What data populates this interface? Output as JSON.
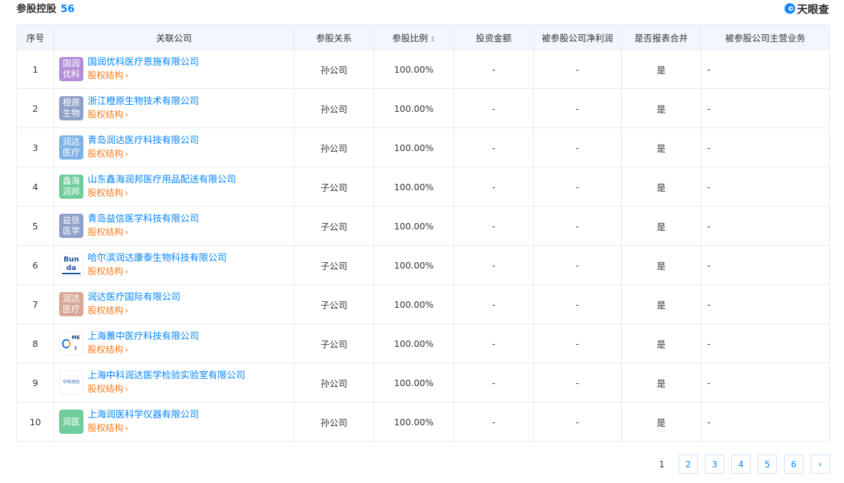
{
  "header": {
    "title": "参股控股",
    "count": "56",
    "brand": "天眼查"
  },
  "columns": [
    "序号",
    "关联公司",
    "参股关系",
    "参股比例",
    "投资金额",
    "被参股公司净利润",
    "是否报表合并",
    "被参股公司主营业务"
  ],
  "sort_icon": "⇕",
  "rows": [
    {
      "no": "1",
      "logo": "国润优科",
      "logo_color": "#b48fd9",
      "name": "国润优科医疗恩施有限公司",
      "link": "股权结构",
      "relation": "孙公司",
      "ratio": "100.00%",
      "amount": "-",
      "profit": "-",
      "merged": "是",
      "business": "-"
    },
    {
      "no": "2",
      "logo": "橙原生物",
      "logo_color": "#8ea0c8",
      "name": "浙江橙原生物技术有限公司",
      "link": "股权结构",
      "relation": "孙公司",
      "ratio": "100.00%",
      "amount": "-",
      "profit": "-",
      "merged": "是",
      "business": "-"
    },
    {
      "no": "3",
      "logo": "润达医疗",
      "logo_color": "#7fb2e6",
      "name": "青岛润达医疗科技有限公司",
      "link": "股权结构",
      "relation": "孙公司",
      "ratio": "100.00%",
      "amount": "-",
      "profit": "-",
      "merged": "是",
      "business": "-"
    },
    {
      "no": "4",
      "logo": "鑫海润邦",
      "logo_color": "#6fcc9b",
      "name": "山东鑫海润邦医疗用品配送有限公司",
      "link": "股权结构",
      "relation": "子公司",
      "ratio": "100.00%",
      "amount": "-",
      "profit": "-",
      "merged": "是",
      "business": "-"
    },
    {
      "no": "5",
      "logo": "益信医学",
      "logo_color": "#8ea0c8",
      "name": "青岛益信医学科技有限公司",
      "link": "股权结构",
      "relation": "子公司",
      "ratio": "100.00%",
      "amount": "-",
      "profit": "-",
      "merged": "是",
      "business": "-"
    },
    {
      "no": "6",
      "logo": "Bunda",
      "logo_color": "#ffffff",
      "name": "哈尔滨润达康泰生物科技有限公司",
      "link": "股权结构",
      "relation": "子公司",
      "ratio": "100.00%",
      "amount": "-",
      "profit": "-",
      "merged": "是",
      "business": "-"
    },
    {
      "no": "7",
      "logo": "润达医疗",
      "logo_color": "#d8a896",
      "name": "润达医疗国际有限公司",
      "link": "股权结构",
      "relation": "子公司",
      "ratio": "100.00%",
      "amount": "-",
      "profit": "-",
      "merged": "是",
      "business": "-"
    },
    {
      "no": "8",
      "logo": "MEI",
      "logo_color": "#ffffff",
      "name": "上海蕙中医疗科技有限公司",
      "link": "股权结构",
      "relation": "子公司",
      "ratio": "100.00%",
      "amount": "-",
      "profit": "-",
      "merged": "是",
      "business": "-"
    },
    {
      "no": "9",
      "logo": "中科润达",
      "logo_color": "#ffffff",
      "name": "上海中科润达医学检验实验室有限公司",
      "link": "股权结构",
      "relation": "孙公司",
      "ratio": "100.00%",
      "amount": "-",
      "profit": "-",
      "merged": "是",
      "business": "-"
    },
    {
      "no": "10",
      "logo": "润医",
      "logo_color": "#6fcc9b",
      "name": "上海润医科学仪器有限公司",
      "link": "股权结构",
      "relation": "孙公司",
      "ratio": "100.00%",
      "amount": "-",
      "profit": "-",
      "merged": "是",
      "business": "-"
    }
  ],
  "pager": {
    "current": "1",
    "pages": [
      "2",
      "3",
      "4",
      "5",
      "6"
    ],
    "next": "›"
  }
}
